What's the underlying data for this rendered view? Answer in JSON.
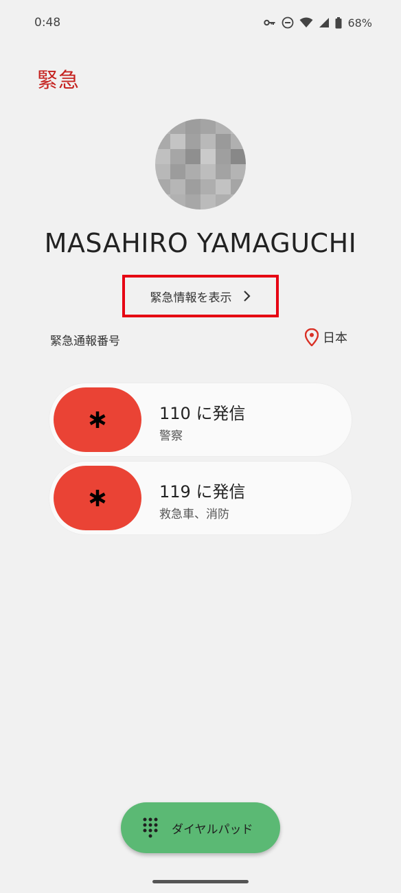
{
  "status_bar": {
    "time": "0:48",
    "battery": "68%",
    "icons": [
      "vpn-key-icon",
      "do-not-disturb-icon",
      "wifi-icon",
      "signal-icon",
      "battery-icon"
    ]
  },
  "header": {
    "title": "緊急"
  },
  "owner": {
    "name": "MASAHIRO YAMAGUCHI",
    "avatar": "pixelated-avatar"
  },
  "info_button": {
    "label": "緊急情報を表示",
    "icon": "chevron-right-icon"
  },
  "emergency_numbers": {
    "label": "緊急通報番号",
    "location": "日本",
    "location_icon": "location-pin-icon"
  },
  "calls": [
    {
      "title": "110 に発信",
      "subtitle": "警察",
      "icon": "asterisk-icon"
    },
    {
      "title": "119 に発信",
      "subtitle": "救急車、消防",
      "icon": "asterisk-icon"
    }
  ],
  "dialpad": {
    "label": "ダイヤルパッド",
    "icon": "dialpad-icon"
  },
  "colors": {
    "title": "#c5221f",
    "call_pill": "#ea4335",
    "fab": "#5bb974",
    "highlight_border": "#e60012",
    "background": "#f1f1f1"
  }
}
